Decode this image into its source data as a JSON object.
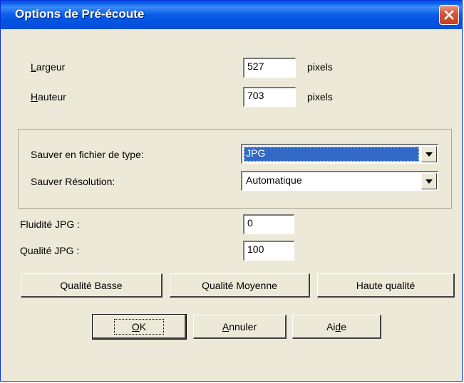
{
  "window": {
    "title": "Options de Pré-écoute"
  },
  "size": {
    "width_label_u": "L",
    "width_label_rest": "argeur",
    "width_value": "527",
    "width_unit": "pixels",
    "height_label_u": "H",
    "height_label_rest": "auteur",
    "height_value": "703",
    "height_unit": "pixels"
  },
  "save": {
    "filetype_label": "Sauver en fichier de type:",
    "filetype_value": "JPG",
    "resolution_label": "Sauver Résolution:",
    "resolution_value": "Automatique"
  },
  "jpg": {
    "smooth_label": "Fluidité JPG :",
    "smooth_value": "0",
    "quality_label": "Qualité JPG :",
    "quality_value": "100"
  },
  "presets": {
    "low": "Qualité Basse",
    "medium": "Qualité Moyenne",
    "high": "Haute qualité"
  },
  "actions": {
    "ok_u": "O",
    "ok_rest": "K",
    "cancel_u": "A",
    "cancel_rest": "nnuler",
    "help_pre": "Ai",
    "help_u": "d",
    "help_post": "e"
  }
}
